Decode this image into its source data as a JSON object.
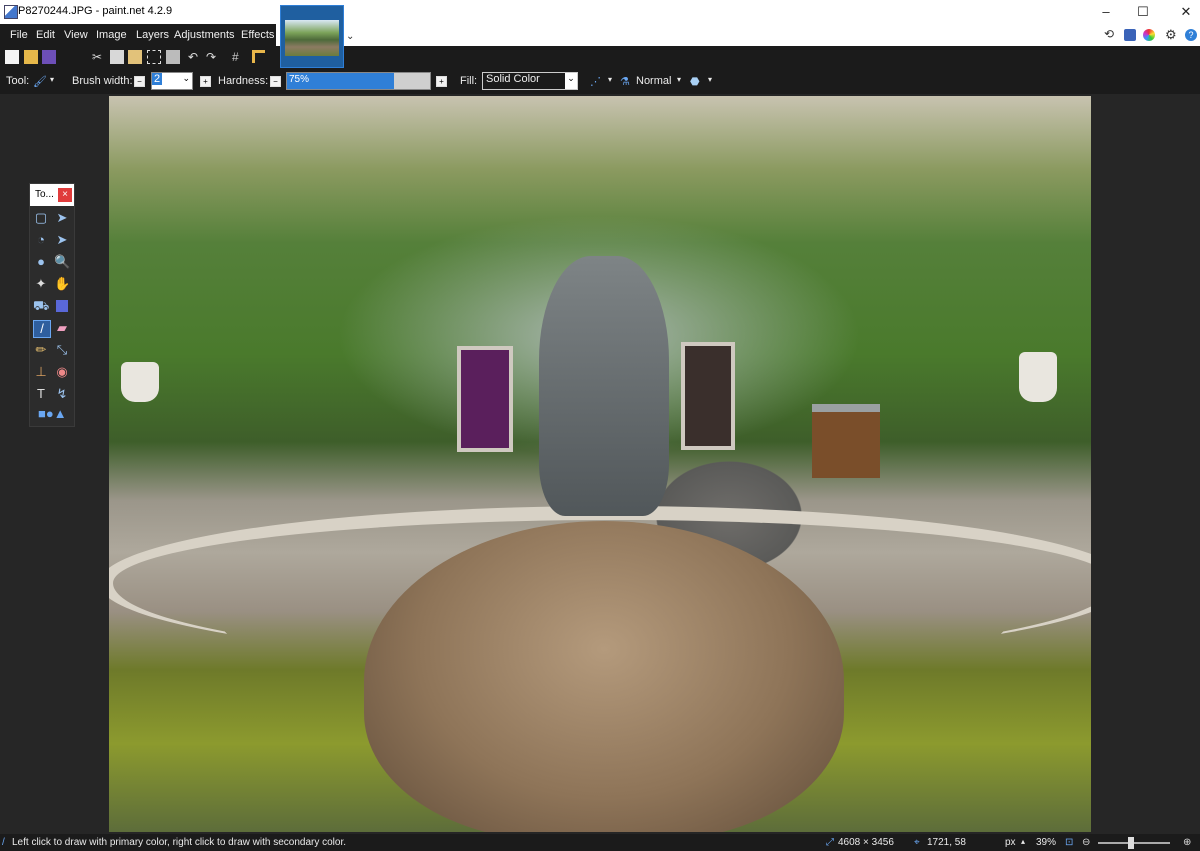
{
  "window": {
    "title": "P8270244.JPG - paint.net 4.2.9"
  },
  "menu": [
    "File",
    "Edit",
    "View",
    "Image",
    "Layers",
    "Adjustments",
    "Effects"
  ],
  "toolbar_options": {
    "tool_label": "Tool:",
    "brush_width_label": "Brush width:",
    "brush_width_value": "2",
    "hardness_label": "Hardness:",
    "hardness_value": "75%",
    "hardness_fraction": 0.75,
    "fill_label": "Fill:",
    "fill_value": "Solid Color",
    "blend_mode": "Normal"
  },
  "tools_panel": {
    "title": "To...",
    "close": "×"
  },
  "status": {
    "hint": "Left click to draw with primary color, right click to draw with secondary color.",
    "image_size": "4608 × 3456",
    "cursor_pos": "1721, 58",
    "units": "px",
    "zoom": "39%"
  },
  "colors": {
    "accent": "#2f7fd7",
    "dark": "#1b1b1b",
    "panel": "#232323"
  }
}
